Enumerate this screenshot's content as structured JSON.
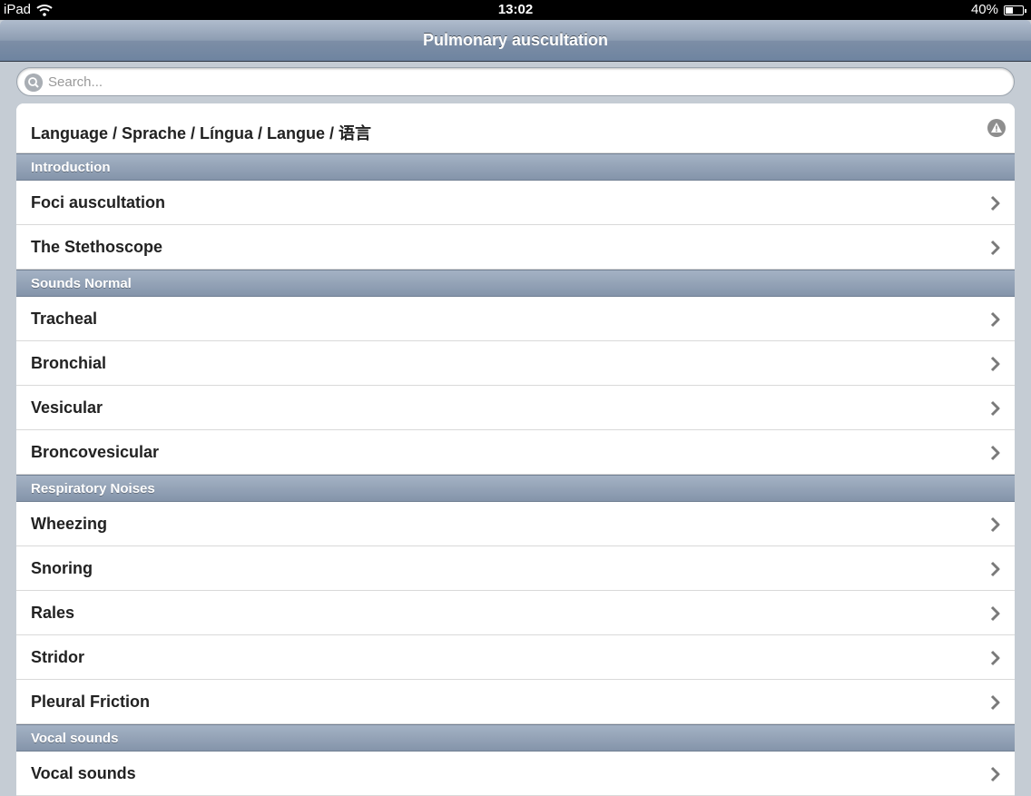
{
  "status": {
    "device": "iPad",
    "time": "13:02",
    "battery": "40%",
    "battery_level": 0.4
  },
  "nav": {
    "title": "Pulmonary auscultation"
  },
  "search": {
    "placeholder": "Search..."
  },
  "language_row": {
    "label": "Language / Sprache / Língua / Langue / 语言",
    "icon": "warning-icon"
  },
  "sections": [
    {
      "title": "Introduction",
      "items": [
        "Foci auscultation",
        "The Stethoscope"
      ]
    },
    {
      "title": "Sounds Normal",
      "items": [
        "Tracheal",
        "Bronchial",
        "Vesicular",
        "Broncovesicular"
      ]
    },
    {
      "title": "Respiratory Noises",
      "items": [
        "Wheezing",
        "Snoring",
        "Rales",
        "Stridor",
        "Pleural Friction"
      ]
    },
    {
      "title": "Vocal sounds",
      "items": [
        "Vocal sounds"
      ]
    }
  ]
}
